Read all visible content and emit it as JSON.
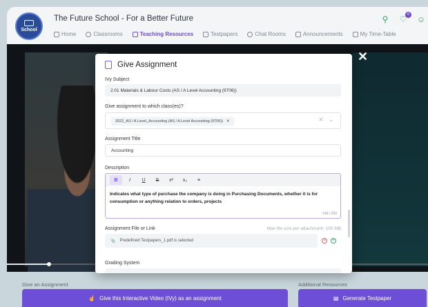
{
  "header": {
    "logo_text": "School",
    "title": "The Future School - For a Better Future",
    "nav": [
      {
        "label": "Home",
        "icon": "home-icon"
      },
      {
        "label": "Classrooms",
        "icon": "classrooms-icon"
      },
      {
        "label": "Teaching Resources",
        "icon": "resources-icon",
        "active": true
      },
      {
        "label": "Testpapers",
        "icon": "testpapers-icon"
      },
      {
        "label": "Chat Rooms",
        "icon": "chat-icon"
      },
      {
        "label": "Announcements",
        "icon": "megaphone-icon"
      },
      {
        "label": "My Time-Table",
        "icon": "calendar-icon"
      }
    ],
    "notification_count": "0"
  },
  "modal": {
    "title": "Give Assignment",
    "ivy_subject_label": "IVy Subject",
    "ivy_subject_value": "2.01 Materials & Labour Costs (AS / A Level Accounting (9706))",
    "class_label": "Give assignment to which class(es)?",
    "class_chip": "2022_AS / A Level_Accounting (AS / A Level Accounting (9706))",
    "assignment_title_label": "Assignment Title",
    "assignment_title_value": "Accounting",
    "description_label": "Description",
    "description_text": "Indicates what type of purchase the company is doing in Purchasing Documents, whether it is for consumption or anything relation to orders, projects",
    "char_counter": "148 / 250",
    "file_label": "Assignment File or Link",
    "max_file_size": "Max file size per attachment- 100 MB",
    "file_value": "Predefined Testpapers_1.pdf is selected",
    "grading_label": "Grading System"
  },
  "bottom": {
    "give_assignment_label": "Give an Assignment",
    "give_assignment_button": "Give this Interactive Video (IVy) as an assignment",
    "additional_label": "Additional Resources",
    "generate_button": "Generate Testpaper"
  },
  "video": {
    "progress": 0.1
  },
  "colors": {
    "accent": "#6c4fd6",
    "green": "#3aa36b"
  }
}
